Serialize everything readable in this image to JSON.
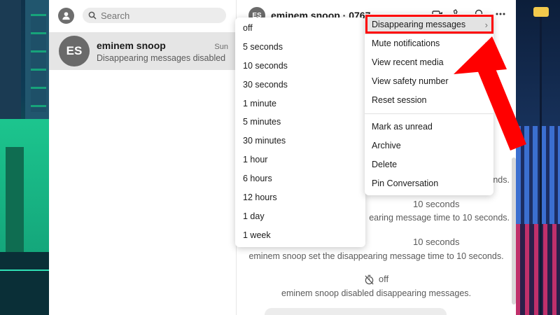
{
  "sidebar": {
    "search": {
      "placeholder": "Search"
    },
    "conversation": {
      "avatar_initials": "ES",
      "name": "eminem snoop",
      "time": "Sun",
      "preview": "Disappearing messages disabled"
    }
  },
  "chat": {
    "header": {
      "avatar_initials": "ES",
      "title": "eminem snoop · 0767"
    },
    "messages": {
      "m1_tail": "onds.",
      "m2_label": "10 seconds",
      "m2_text": "earing message time to 10 seconds.",
      "m3_label": "10 seconds",
      "m3_text": "eminem snoop set the disappearing message time to 10 seconds.",
      "m4_label": "off",
      "m4_text": "eminem snoop disabled disappearing messages."
    }
  },
  "timer_menu": {
    "options": [
      "off",
      "5 seconds",
      "10 seconds",
      "30 seconds",
      "1 minute",
      "5 minutes",
      "30 minutes",
      "1 hour",
      "6 hours",
      "12 hours",
      "1 day",
      "1 week"
    ]
  },
  "options_menu": {
    "items": [
      {
        "label": "Disappearing messages",
        "has_submenu": true,
        "highlighted": true
      },
      {
        "label": "Mute notifications",
        "has_submenu": true
      },
      {
        "label": "View recent media"
      },
      {
        "label": "View safety number"
      },
      {
        "label": "Reset session"
      },
      {
        "label": "Mark as unread"
      },
      {
        "label": "Archive"
      },
      {
        "label": "Delete"
      },
      {
        "label": "Pin Conversation"
      }
    ]
  },
  "colors": {
    "highlight_border": "#ff0000",
    "arrow": "#ff0000",
    "selected_row": "#e5e5e5",
    "avatar": "#6a6a6a"
  }
}
